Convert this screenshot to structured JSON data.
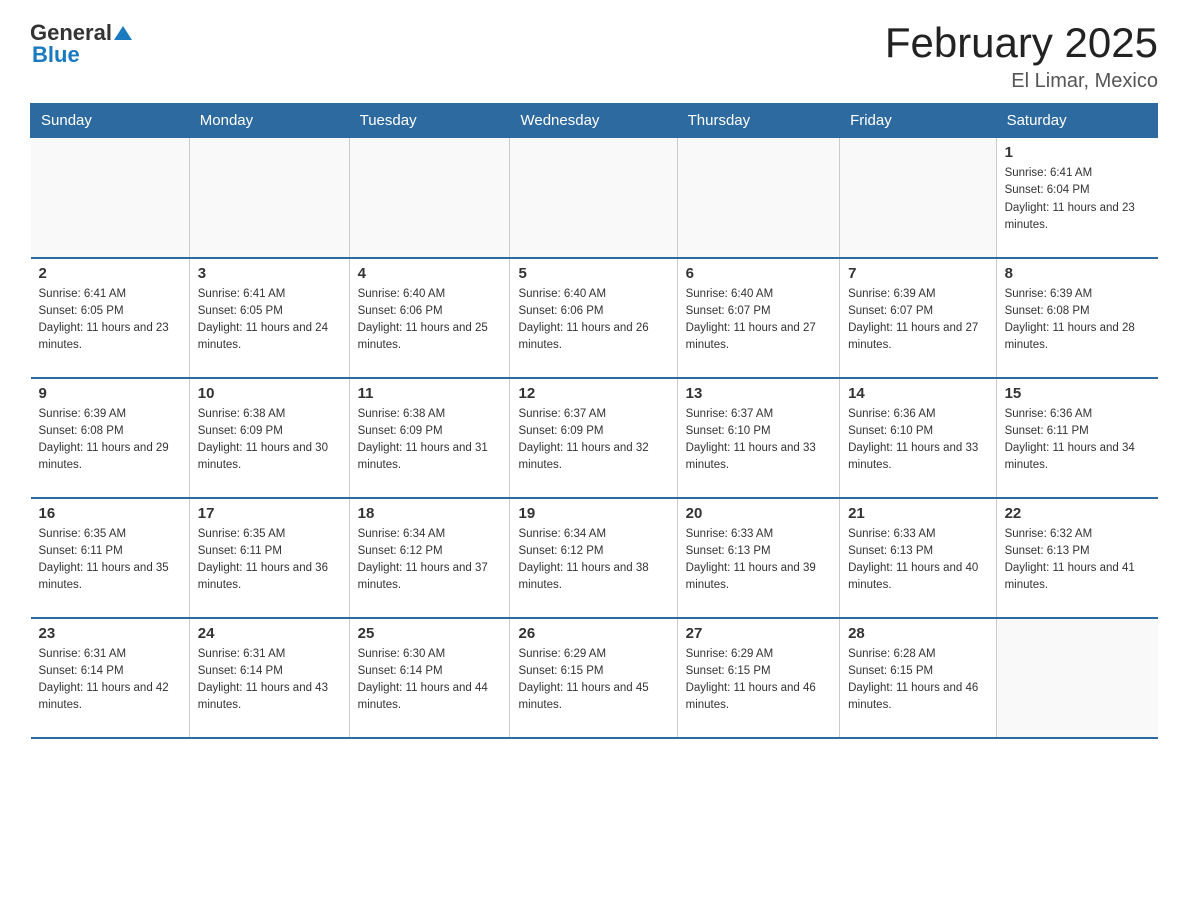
{
  "header": {
    "logo_general": "General",
    "logo_blue": "Blue",
    "month_title": "February 2025",
    "location": "El Limar, Mexico"
  },
  "days_of_week": [
    "Sunday",
    "Monday",
    "Tuesday",
    "Wednesday",
    "Thursday",
    "Friday",
    "Saturday"
  ],
  "weeks": [
    [
      {
        "day": "",
        "sunrise": "",
        "sunset": "",
        "daylight": ""
      },
      {
        "day": "",
        "sunrise": "",
        "sunset": "",
        "daylight": ""
      },
      {
        "day": "",
        "sunrise": "",
        "sunset": "",
        "daylight": ""
      },
      {
        "day": "",
        "sunrise": "",
        "sunset": "",
        "daylight": ""
      },
      {
        "day": "",
        "sunrise": "",
        "sunset": "",
        "daylight": ""
      },
      {
        "day": "",
        "sunrise": "",
        "sunset": "",
        "daylight": ""
      },
      {
        "day": "1",
        "sunrise": "Sunrise: 6:41 AM",
        "sunset": "Sunset: 6:04 PM",
        "daylight": "Daylight: 11 hours and 23 minutes."
      }
    ],
    [
      {
        "day": "2",
        "sunrise": "Sunrise: 6:41 AM",
        "sunset": "Sunset: 6:05 PM",
        "daylight": "Daylight: 11 hours and 23 minutes."
      },
      {
        "day": "3",
        "sunrise": "Sunrise: 6:41 AM",
        "sunset": "Sunset: 6:05 PM",
        "daylight": "Daylight: 11 hours and 24 minutes."
      },
      {
        "day": "4",
        "sunrise": "Sunrise: 6:40 AM",
        "sunset": "Sunset: 6:06 PM",
        "daylight": "Daylight: 11 hours and 25 minutes."
      },
      {
        "day": "5",
        "sunrise": "Sunrise: 6:40 AM",
        "sunset": "Sunset: 6:06 PM",
        "daylight": "Daylight: 11 hours and 26 minutes."
      },
      {
        "day": "6",
        "sunrise": "Sunrise: 6:40 AM",
        "sunset": "Sunset: 6:07 PM",
        "daylight": "Daylight: 11 hours and 27 minutes."
      },
      {
        "day": "7",
        "sunrise": "Sunrise: 6:39 AM",
        "sunset": "Sunset: 6:07 PM",
        "daylight": "Daylight: 11 hours and 27 minutes."
      },
      {
        "day": "8",
        "sunrise": "Sunrise: 6:39 AM",
        "sunset": "Sunset: 6:08 PM",
        "daylight": "Daylight: 11 hours and 28 minutes."
      }
    ],
    [
      {
        "day": "9",
        "sunrise": "Sunrise: 6:39 AM",
        "sunset": "Sunset: 6:08 PM",
        "daylight": "Daylight: 11 hours and 29 minutes."
      },
      {
        "day": "10",
        "sunrise": "Sunrise: 6:38 AM",
        "sunset": "Sunset: 6:09 PM",
        "daylight": "Daylight: 11 hours and 30 minutes."
      },
      {
        "day": "11",
        "sunrise": "Sunrise: 6:38 AM",
        "sunset": "Sunset: 6:09 PM",
        "daylight": "Daylight: 11 hours and 31 minutes."
      },
      {
        "day": "12",
        "sunrise": "Sunrise: 6:37 AM",
        "sunset": "Sunset: 6:09 PM",
        "daylight": "Daylight: 11 hours and 32 minutes."
      },
      {
        "day": "13",
        "sunrise": "Sunrise: 6:37 AM",
        "sunset": "Sunset: 6:10 PM",
        "daylight": "Daylight: 11 hours and 33 minutes."
      },
      {
        "day": "14",
        "sunrise": "Sunrise: 6:36 AM",
        "sunset": "Sunset: 6:10 PM",
        "daylight": "Daylight: 11 hours and 33 minutes."
      },
      {
        "day": "15",
        "sunrise": "Sunrise: 6:36 AM",
        "sunset": "Sunset: 6:11 PM",
        "daylight": "Daylight: 11 hours and 34 minutes."
      }
    ],
    [
      {
        "day": "16",
        "sunrise": "Sunrise: 6:35 AM",
        "sunset": "Sunset: 6:11 PM",
        "daylight": "Daylight: 11 hours and 35 minutes."
      },
      {
        "day": "17",
        "sunrise": "Sunrise: 6:35 AM",
        "sunset": "Sunset: 6:11 PM",
        "daylight": "Daylight: 11 hours and 36 minutes."
      },
      {
        "day": "18",
        "sunrise": "Sunrise: 6:34 AM",
        "sunset": "Sunset: 6:12 PM",
        "daylight": "Daylight: 11 hours and 37 minutes."
      },
      {
        "day": "19",
        "sunrise": "Sunrise: 6:34 AM",
        "sunset": "Sunset: 6:12 PM",
        "daylight": "Daylight: 11 hours and 38 minutes."
      },
      {
        "day": "20",
        "sunrise": "Sunrise: 6:33 AM",
        "sunset": "Sunset: 6:13 PM",
        "daylight": "Daylight: 11 hours and 39 minutes."
      },
      {
        "day": "21",
        "sunrise": "Sunrise: 6:33 AM",
        "sunset": "Sunset: 6:13 PM",
        "daylight": "Daylight: 11 hours and 40 minutes."
      },
      {
        "day": "22",
        "sunrise": "Sunrise: 6:32 AM",
        "sunset": "Sunset: 6:13 PM",
        "daylight": "Daylight: 11 hours and 41 minutes."
      }
    ],
    [
      {
        "day": "23",
        "sunrise": "Sunrise: 6:31 AM",
        "sunset": "Sunset: 6:14 PM",
        "daylight": "Daylight: 11 hours and 42 minutes."
      },
      {
        "day": "24",
        "sunrise": "Sunrise: 6:31 AM",
        "sunset": "Sunset: 6:14 PM",
        "daylight": "Daylight: 11 hours and 43 minutes."
      },
      {
        "day": "25",
        "sunrise": "Sunrise: 6:30 AM",
        "sunset": "Sunset: 6:14 PM",
        "daylight": "Daylight: 11 hours and 44 minutes."
      },
      {
        "day": "26",
        "sunrise": "Sunrise: 6:29 AM",
        "sunset": "Sunset: 6:15 PM",
        "daylight": "Daylight: 11 hours and 45 minutes."
      },
      {
        "day": "27",
        "sunrise": "Sunrise: 6:29 AM",
        "sunset": "Sunset: 6:15 PM",
        "daylight": "Daylight: 11 hours and 46 minutes."
      },
      {
        "day": "28",
        "sunrise": "Sunrise: 6:28 AM",
        "sunset": "Sunset: 6:15 PM",
        "daylight": "Daylight: 11 hours and 46 minutes."
      },
      {
        "day": "",
        "sunrise": "",
        "sunset": "",
        "daylight": ""
      }
    ]
  ]
}
